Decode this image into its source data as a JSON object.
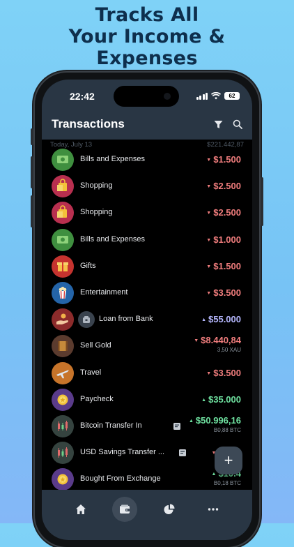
{
  "promo": {
    "lines": [
      "Tracks All",
      "Your Income &",
      "Expenses"
    ]
  },
  "status_bar": {
    "time": "22:42",
    "battery": "62"
  },
  "header": {
    "title": "Transactions",
    "filter_icon": "filter-icon",
    "search_icon": "search-icon"
  },
  "list_header": {
    "date": "Today, July 13",
    "total": "$221.442,87"
  },
  "transactions": [
    {
      "name": "Bills and Expenses",
      "amount": "$1.500",
      "kind": "expense",
      "icon": "money-icon",
      "icon_color": "#3f8f3f"
    },
    {
      "name": "Shopping",
      "amount": "$2.500",
      "kind": "expense",
      "icon": "shopping-bag-icon",
      "icon_color": "#b82f4f"
    },
    {
      "name": "Shopping",
      "amount": "$2.500",
      "kind": "expense",
      "icon": "shopping-bag-icon",
      "icon_color": "#b82f4f"
    },
    {
      "name": "Bills and Expenses",
      "amount": "$1.000",
      "kind": "expense",
      "icon": "money-icon",
      "icon_color": "#3f8f3f"
    },
    {
      "name": "Gifts",
      "amount": "$1.500",
      "kind": "expense",
      "icon": "gift-icon",
      "icon_color": "#c5332f"
    },
    {
      "name": "Entertainment",
      "amount": "$3.500",
      "kind": "expense",
      "icon": "popcorn-icon",
      "icon_color": "#2464a8"
    },
    {
      "name": "Loan from Bank",
      "amount": "$55.000",
      "kind": "transfer",
      "icon": "loan-hand-icon",
      "icon_color": "#8c2b2b",
      "sub_icon": "bank-icon"
    },
    {
      "name": "Sell Gold",
      "amount": "$8.440,84",
      "sub": "3,50 XAU",
      "kind": "expense",
      "icon": "gold-bars-icon",
      "icon_color": "#5b3b2e"
    },
    {
      "name": "Travel",
      "amount": "$3.500",
      "kind": "expense",
      "icon": "airplane-icon",
      "icon_color": "#c7742a"
    },
    {
      "name": "Paycheck",
      "amount": "$35.000",
      "kind": "income",
      "icon": "coin-icon",
      "icon_color": "#5a3b8a"
    },
    {
      "name": "Bitcoin Transfer In",
      "amount": "$50.996,16",
      "sub": "B0,88 BTC",
      "kind": "income",
      "icon": "chart-candles-icon",
      "icon_color": "#35433f",
      "note": "note-icon"
    },
    {
      "name": "USD Savings Transfer ...",
      "amount": "$50.1",
      "sub": "",
      "kind": "expense",
      "icon": "chart-candles-icon",
      "icon_color": "#35433f",
      "note": "note-icon"
    },
    {
      "name": "Bought From Exchange",
      "amount": "$10.4",
      "sub": "B0,18 BTC",
      "kind": "income",
      "icon": "coin-icon",
      "icon_color": "#5a3b8a"
    }
  ],
  "fab": {
    "label": "+"
  },
  "tabbar": {
    "tabs": [
      {
        "name": "home",
        "icon": "home-icon"
      },
      {
        "name": "transactions",
        "icon": "wallet-icon",
        "active": true
      },
      {
        "name": "reports",
        "icon": "pie-chart-icon"
      },
      {
        "name": "more",
        "icon": "more-icon"
      }
    ]
  },
  "colors": {
    "expense": "#f07d7d",
    "income": "#6fe2a0",
    "transfer": "#b6b8ff",
    "header_bg": "#293644",
    "headline": "#0e2f4d"
  }
}
